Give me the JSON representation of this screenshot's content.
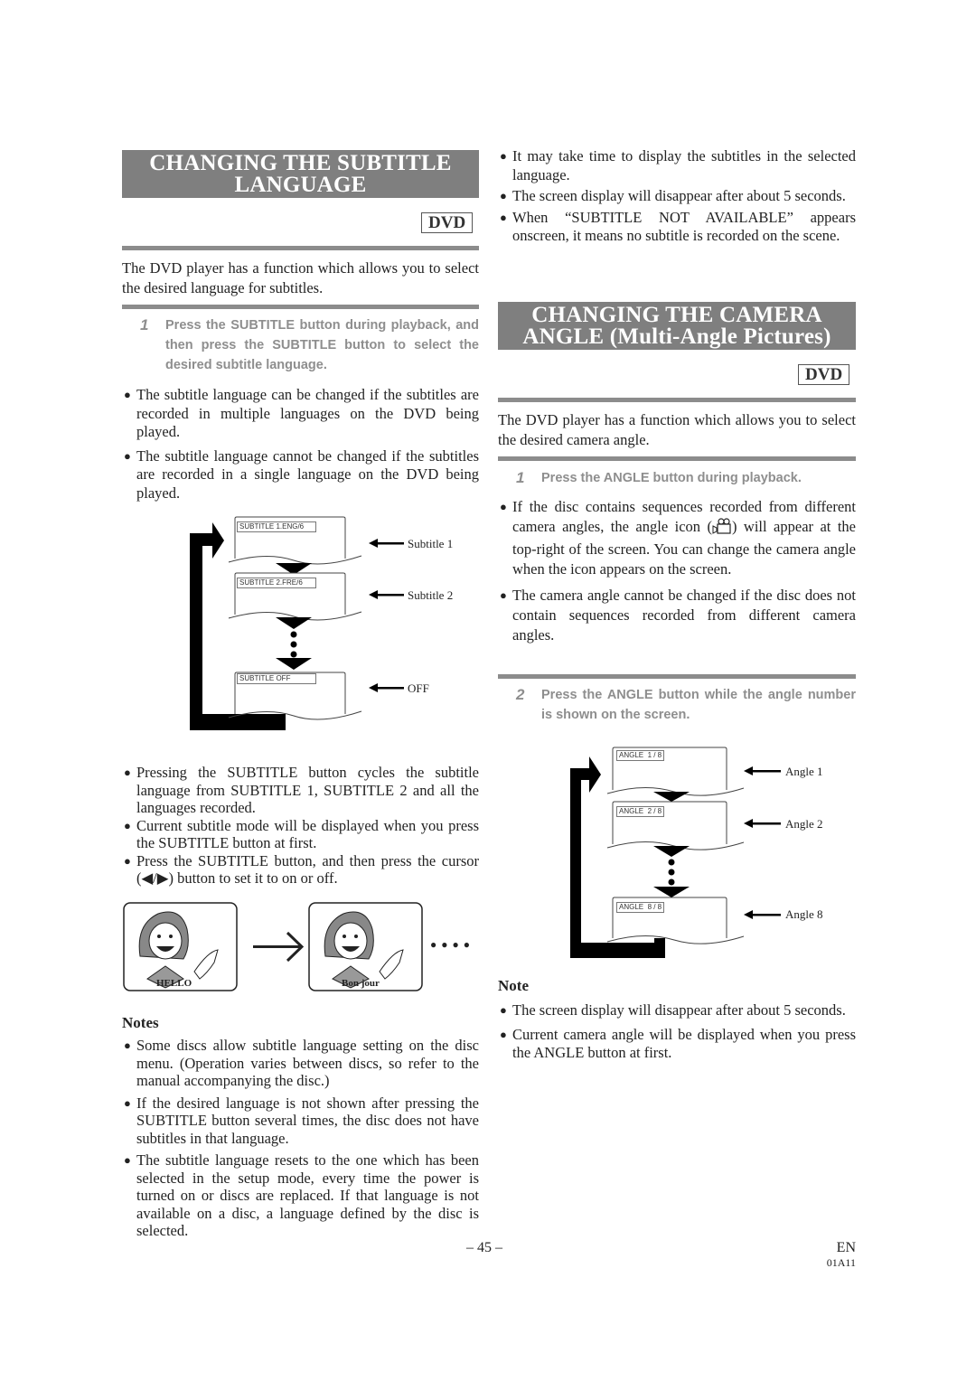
{
  "left": {
    "title_line1": "CHANGING THE SUBTITLE",
    "title_line2": "LANGUAGE",
    "badge": "DVD",
    "intro": "The DVD player has a function which allows you to select the desired language for subtitles.",
    "step1": {
      "number": "1",
      "text": "Press the SUBTITLE button during playback, and then press the SUBTITLE button to select the desired subtitle language."
    },
    "bullets_a": [
      "The subtitle language can be changed if the subtitles are recorded in multiple languages on the DVD being played.",
      "The subtitle language cannot be changed if the subtitles are recorded in a single language on the DVD being played."
    ],
    "diagram": {
      "screens": [
        {
          "tag": "SUBTITLE 1.ENG/6",
          "label": "Subtitle 1"
        },
        {
          "tag": "SUBTITLE 2.FRE/6",
          "label": "Subtitle 2"
        },
        {
          "tag": "SUBTITLE OFF",
          "label": "OFF"
        }
      ]
    },
    "bullets_b": [
      "Pressing the SUBTITLE button cycles the subtitle language from SUBTITLE 1, SUBTITLE 2 and all the languages recorded.",
      "Current subtitle mode will be displayed when you press the SUBTITLE button at first.",
      "Press the SUBTITLE button, and then press the cursor (◀/▶) button to set it to on or off."
    ],
    "illustration": {
      "caption1": "HELLO",
      "caption2": "Bon jour",
      "ellipsis": "● ● ● ●"
    },
    "notes_title": "Notes",
    "notes": [
      "Some discs allow subtitle language setting on the disc menu. (Operation varies between discs, so refer to the manual accompanying the disc.)",
      "If the desired language is not shown after pressing the SUBTITLE button several times, the disc does not have subtitles in that language.",
      "The subtitle language resets to the one which has been selected in the setup mode, every time the power is turned on or discs are replaced. If that language is not available on a disc, a language defined by the disc is selected."
    ]
  },
  "right": {
    "bullets_top": [
      "It may take time to display the subtitles in the selected language.",
      "The screen display will disappear after about 5 seconds.",
      "When “SUBTITLE NOT AVAILABLE” appears onscreen, it means no subtitle is recorded on the scene."
    ],
    "title_line1": "CHANGING THE CAMERA",
    "title_line2": "ANGLE (Multi-Angle Pictures)",
    "badge": "DVD",
    "intro": "The DVD player has a function which allows you to select the desired camera angle.",
    "step1": {
      "number": "1",
      "text": "Press the ANGLE button during playback."
    },
    "bullets_a": [
      {
        "before": "If the disc contains sequences recorded from different camera angles, the angle icon (",
        "icon": "camera-angle-icon",
        "after": ") will appear at the top-right of the screen. You can change the camera angle when the icon appears on the screen."
      },
      {
        "text": "The camera angle cannot be changed if the disc does not contain sequences recorded from different camera angles."
      }
    ],
    "step2": {
      "number": "2",
      "text": "Press the ANGLE button while the angle number is shown on the screen."
    },
    "diagram": {
      "screens": [
        {
          "tag": "ANGLE  1 / 8",
          "label": "Angle 1"
        },
        {
          "tag": "ANGLE  2 / 8",
          "label": "Angle 2"
        },
        {
          "tag": "ANGLE  8 / 8",
          "label": "Angle 8"
        }
      ]
    },
    "note_title": "Note",
    "notes": [
      "The screen display will disappear after about 5 seconds.",
      "Current camera angle will be displayed when you press the ANGLE button at first."
    ]
  },
  "footer": {
    "page_number": "– 45 –",
    "language": "EN",
    "code": "01A11"
  }
}
